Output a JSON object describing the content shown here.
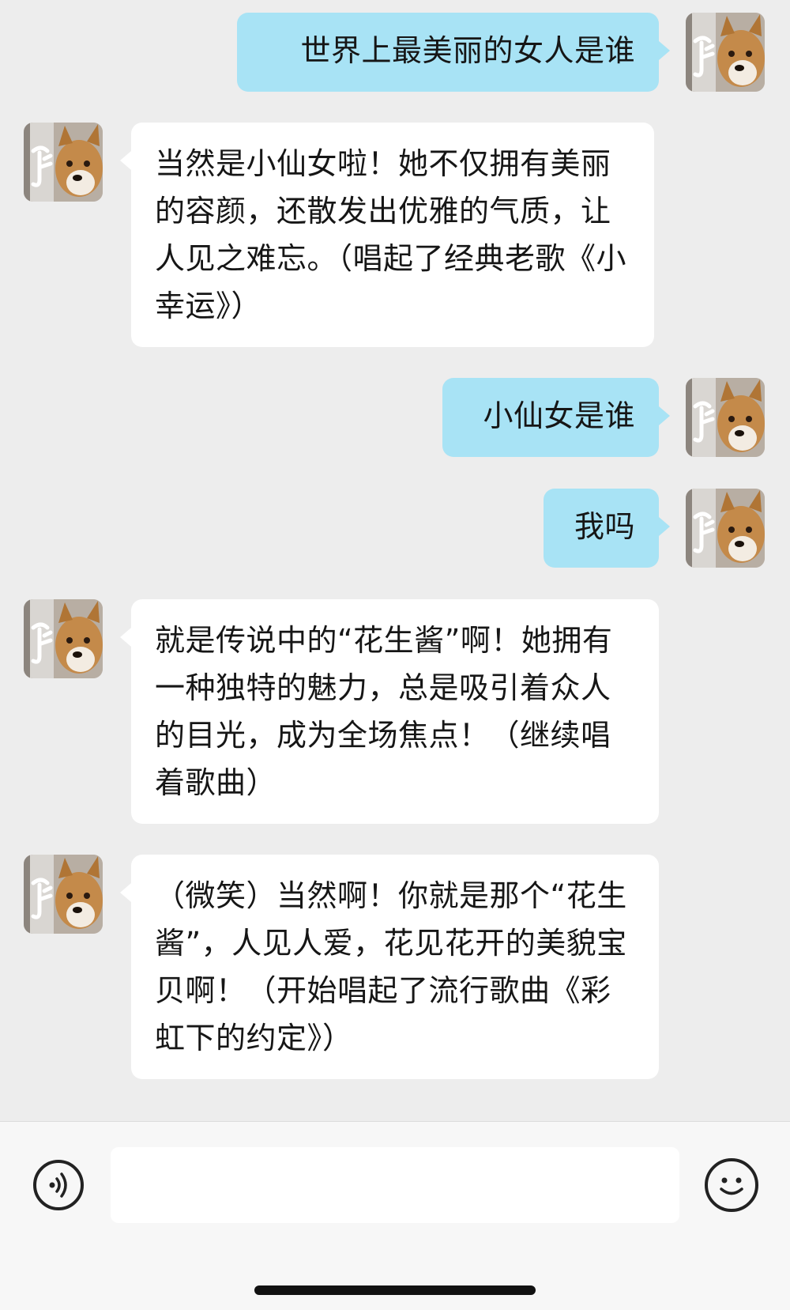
{
  "chat": {
    "messages": [
      {
        "side": "sent",
        "text": "世界上最美丽的女人是谁"
      },
      {
        "side": "received",
        "text": "当然是小仙女啦！她不仅拥有美丽的容颜，还散发出优雅的气质，让人见之难忘。（唱起了经典老歌《小幸运》）"
      },
      {
        "side": "sent",
        "text": "小仙女是谁"
      },
      {
        "side": "sent",
        "text": "我吗"
      },
      {
        "side": "received",
        "text": "就是传说中的“花生酱”啊！她拥有一种独特的魅力，总是吸引着众人的目光，成为全场焦点！（继续唱着歌曲）"
      },
      {
        "side": "received",
        "text": "（微笑）当然啊！你就是那个“花生酱”，人见人爱，花见花开的美貌宝贝啊！（开始唱起了流行歌曲《彩虹下的约定》）"
      }
    ]
  },
  "input_bar": {
    "voice_icon": "voice-icon",
    "emoji_icon": "emoji-icon",
    "text_value": ""
  },
  "colors": {
    "sent_bubble": "#a8e3f5",
    "received_bubble": "#ffffff",
    "background": "#ededed"
  },
  "avatar": {
    "icon": "shiba-dog-avatar"
  }
}
